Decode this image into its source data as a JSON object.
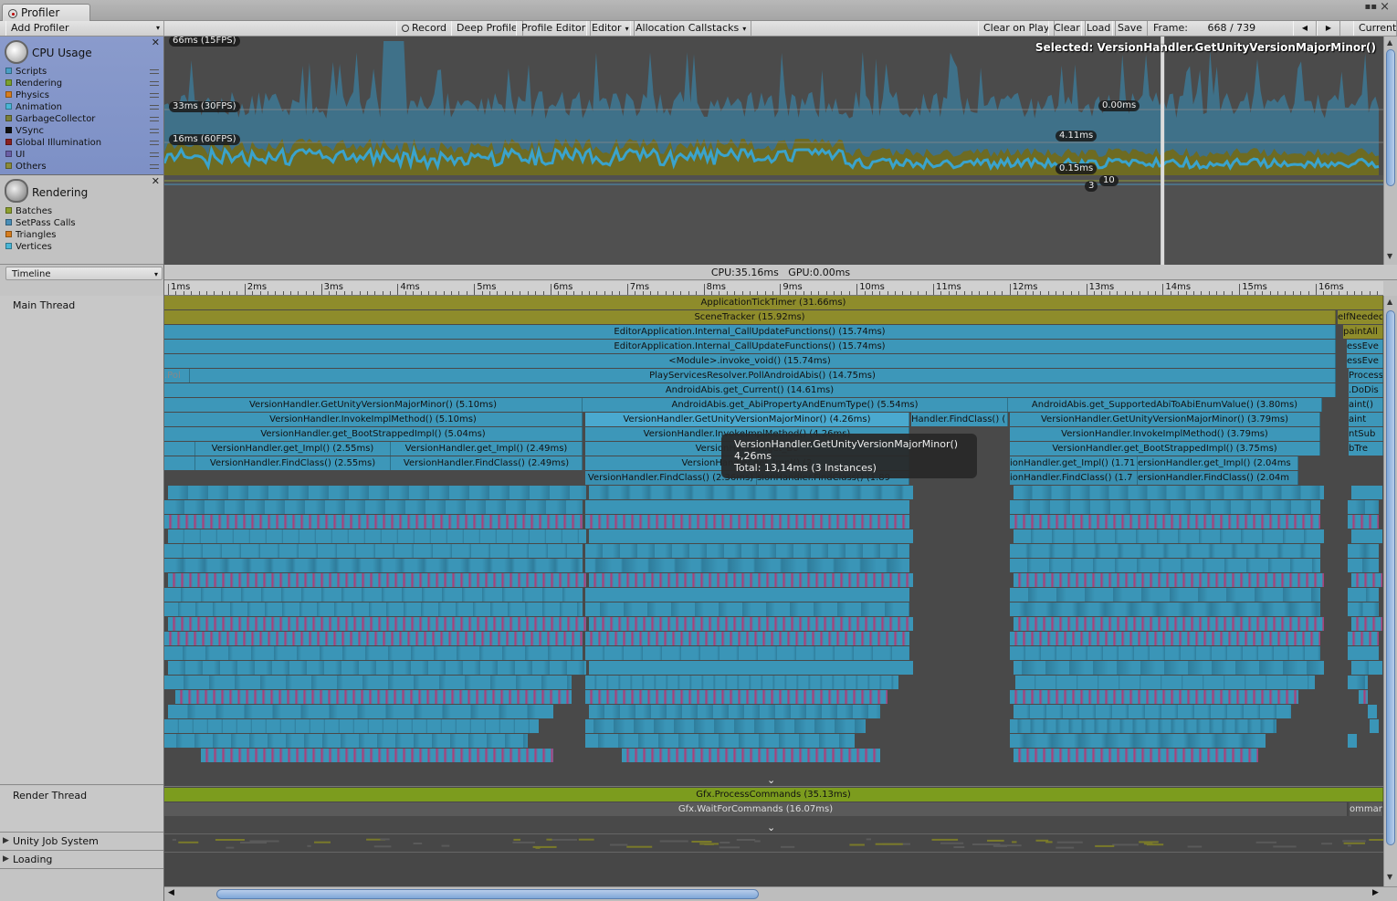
{
  "window": {
    "tab_title": "Profiler",
    "menu_glyph": "▪▪",
    "close_glyph": "×"
  },
  "toolbar": {
    "add_profiler": "Add Profiler",
    "record": "Record",
    "deep_profile": "Deep Profile",
    "profile_editor": "Profile Editor",
    "editor": "Editor",
    "allocation_callstacks": "Allocation Callstacks",
    "clear_on_play": "Clear on Play",
    "clear": "Clear",
    "load": "Load",
    "save": "Save",
    "frame_label": "Frame:",
    "frame_value": "668 / 739",
    "prev_glyph": "◀",
    "next_glyph": "▶",
    "current": "Current"
  },
  "cpu_module": {
    "title": "CPU Usage",
    "items": [
      {
        "label": "Scripts",
        "color": "#4a9fc6"
      },
      {
        "label": "Rendering",
        "color": "#7ca12e"
      },
      {
        "label": "Physics",
        "color": "#d67d1e"
      },
      {
        "label": "Animation",
        "color": "#49b6d6"
      },
      {
        "label": "GarbageCollector",
        "color": "#7a7f3a"
      },
      {
        "label": "VSync",
        "color": "#111111"
      },
      {
        "label": "Global Illumination",
        "color": "#8a2020"
      },
      {
        "label": "UI",
        "color": "#6a5fa6"
      },
      {
        "label": "Others",
        "color": "#8b8b3a"
      }
    ]
  },
  "render_module": {
    "title": "Rendering",
    "items": [
      {
        "label": "Batches",
        "color": "#8ea12e"
      },
      {
        "label": "SetPass Calls",
        "color": "#4a8fb8"
      },
      {
        "label": "Triangles",
        "color": "#d67d1e"
      },
      {
        "label": "Vertices",
        "color": "#49b6d6"
      }
    ]
  },
  "view_mode": "Timeline",
  "chart": {
    "line_15": "66ms (15FPS)",
    "line_30": "33ms (30FPS)",
    "line_60": "16ms (60FPS)",
    "selected": "Selected: VersionHandler.GetUnityVersionMajorMinor()",
    "v1": "0.00ms",
    "v2": "4.11ms",
    "v3": "0.15ms",
    "v4": "3",
    "v5": "10",
    "selected_frame": 668,
    "total_frames": 739
  },
  "timing": "CPU:35.16ms   GPU:0.00ms",
  "ruler": [
    "1ms",
    "2ms",
    "3ms",
    "4ms",
    "5ms",
    "6ms",
    "7ms",
    "8ms",
    "9ms",
    "10ms",
    "11ms",
    "12ms",
    "13ms",
    "14ms",
    "15ms",
    "16ms"
  ],
  "threads": {
    "main": "Main Thread",
    "render": "Render Thread",
    "job": "Unity Job System",
    "loading": "Loading",
    "expand_glyph": "▶",
    "collapse_glyph": "⌄"
  },
  "bars": {
    "b0": "ApplicationTickTimer (31.66ms)",
    "b1": "SceneTracker (15.92ms)",
    "b1r": "eIfNeeded",
    "b2": "EditorApplication.Internal_CallUpdateFunctions() (15.74ms)",
    "b2r": "paintAll",
    "b3": "EditorApplication.Internal_CallUpdateFunctions() (15.74ms)",
    "b3r": "essEve",
    "b4": "<Module>.invoke_void() (15.74ms)",
    "b4r": "essEve",
    "b5l": ".Pol",
    "b5": "PlayServicesResolver.PollAndroidAbis() (14.75ms)",
    "b5r": "Process",
    "b6": "AndroidAbis.get_Current() (14.61ms)",
    "b6r": ".DoDis",
    "b7a": "VersionHandler.GetUnityVersionMajorMinor() (5.10ms)",
    "b7b": "AndroidAbis.get_AbiPropertyAndEnumType() (5.54ms)",
    "b7c": "AndroidAbis.get_SupportedAbiToAbiEnumValue() (3.80ms)",
    "b7r": "aint()",
    "b8a": "VersionHandler.InvokeImplMethod() (5.10ms)",
    "b8b": "VersionHandler.GetUnityVersionMajorMinor() (4.26ms)",
    "b8c": "Handler.FindClass() (",
    "b8d": "VersionHandler.GetUnityVersionMajorMinor() (3.79ms)",
    "b8r": "aint",
    "b9a": "VersionHandler.get_BootStrappedImpl() (5.04ms)",
    "b9b": "VersionHandler.InvokeImplMethod() (4.26ms)",
    "b9c": "VersionHandler.InvokeImplMethod() (3.79ms)",
    "b9r": "ntSub",
    "b10a": "VersionHandler.get_Impl() (2.55ms)",
    "b10b": "VersionHandler.get_Impl() (2.49ms)",
    "b10c": "VersionHandler.get_Bo",
    "b10d": "VersionHandler.get_BootStrappedImpl() (3.75ms)",
    "b10r": "bTre",
    "b11a": "VersionHandler.FindClass() (2.55ms)",
    "b11b": "VersionHandler.FindClass() (2.49ms)",
    "b11c": "VersionHandler.get_Impl() (2",
    "b11d": "ionHandler.get_Impl() (1.71",
    "b11e": "ersionHandler.get_Impl() (2.04ms",
    "b12a": "VersionHandler.FindClass() (2.36ms)",
    "b12b": "sionHandler.FindClass() (1.89",
    "b12c": "ionHandler.FindClass() (1.7",
    "b12d": "ersionHandler.FindClass() (2.04m",
    "r0": "Gfx.ProcessCommands (35.13ms)",
    "r1": "Gfx.WaitForCommands (16.07ms)",
    "r1r": "omman"
  },
  "tooltip": {
    "name": "VersionHandler.GetUnityVersionMajorMinor()",
    "time": "4,26ms",
    "total": "Total: 13,14ms (3 Instances)"
  },
  "scroll": {
    "left_glyph": "◀",
    "right_glyph": "▶",
    "up_glyph": "▲",
    "down_glyph": "▼"
  }
}
